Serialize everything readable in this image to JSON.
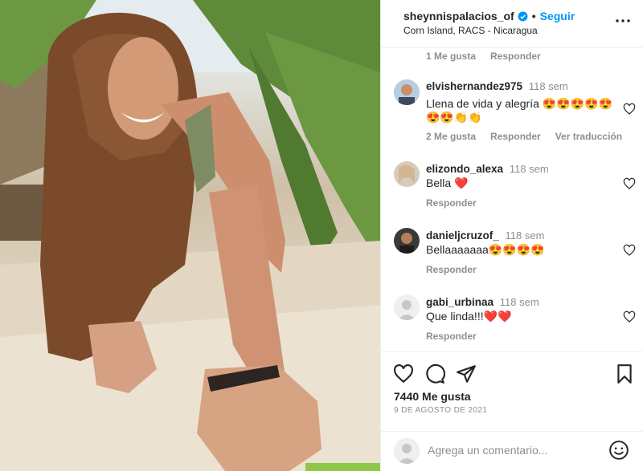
{
  "header": {
    "username": "sheynnispalacios_of",
    "separator": "•",
    "follow_label": "Seguir",
    "location": "Corn Island, RACS - Nicaragua"
  },
  "comments": {
    "top_meta": {
      "likes": "1 Me gusta",
      "reply": "Responder"
    },
    "items": [
      {
        "user": "elvishernandez975",
        "time": "118 sem",
        "text": "Llena de vida y alegría 😍😍😍😍😍😍😍👏👏",
        "likes": "2 Me gusta",
        "reply": "Responder",
        "translate": "Ver traducción"
      },
      {
        "user": "elizondo_alexa",
        "time": "118 sem",
        "text": "Bella ❤️",
        "reply": "Responder"
      },
      {
        "user": "danieljcruzof_",
        "time": "118 sem",
        "text": "Bellaaaaaaa😍😍😍😍",
        "reply": "Responder"
      },
      {
        "user": "gabi_urbinaa",
        "time": "118 sem",
        "text": "Que linda!!!❤️❤️",
        "reply": "Responder"
      }
    ]
  },
  "actions": {
    "likes": "7440 Me gusta",
    "date": "9 DE AGOSTO DE 2021",
    "comment_placeholder": "Agrega un comentario..."
  },
  "colors": {
    "accent": "#0095f6",
    "muted": "#8e8e8e",
    "text": "#262626",
    "heart": "#ed4956"
  }
}
